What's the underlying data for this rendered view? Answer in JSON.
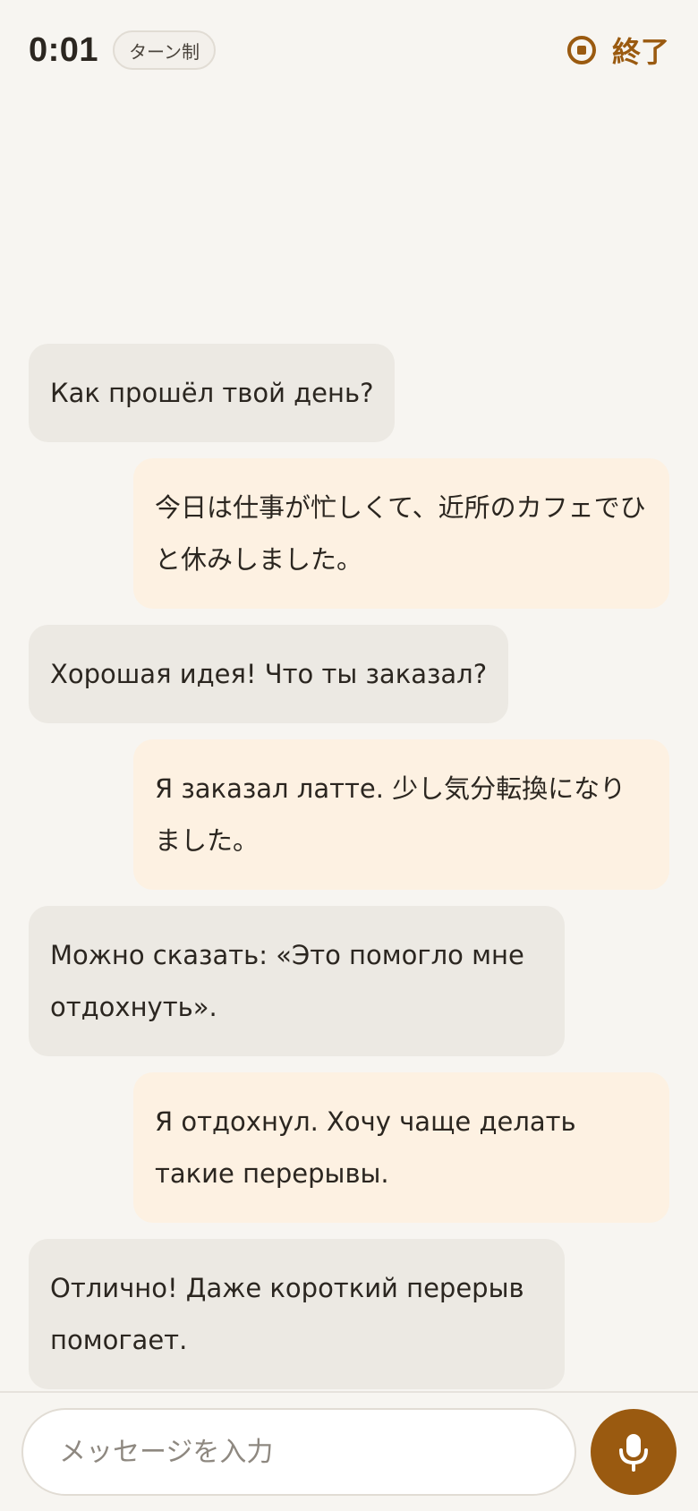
{
  "header": {
    "timer": "0:01",
    "mode_badge": "ターン制",
    "end_label": "終了",
    "stop_icon": "stop-circle-icon"
  },
  "messages": [
    {
      "role": "assistant",
      "text": "Как прошёл твой день?"
    },
    {
      "role": "user",
      "text": "今日は仕事が忙しくて、近所のカフェでひと休みしました。"
    },
    {
      "role": "assistant",
      "text": "Хорошая идея! Что ты заказал?"
    },
    {
      "role": "user",
      "text": "Я заказал латте. 少し気分転換になりました。"
    },
    {
      "role": "assistant",
      "text": "Можно сказать: «Это помогло мне отдохнуть»."
    },
    {
      "role": "user",
      "text": "Я отдохнул. Хочу чаще делать такие перерывы."
    },
    {
      "role": "assistant",
      "text": "Отлично! Даже короткий перерыв помогает."
    }
  ],
  "composer": {
    "placeholder": "メッセージを入力",
    "value": "",
    "mic_icon": "microphone-icon"
  },
  "colors": {
    "accent": "#9a5a10",
    "background": "#f7f5f1",
    "assistant_bubble": "#ece9e3",
    "user_bubble": "#fdf1e2"
  }
}
